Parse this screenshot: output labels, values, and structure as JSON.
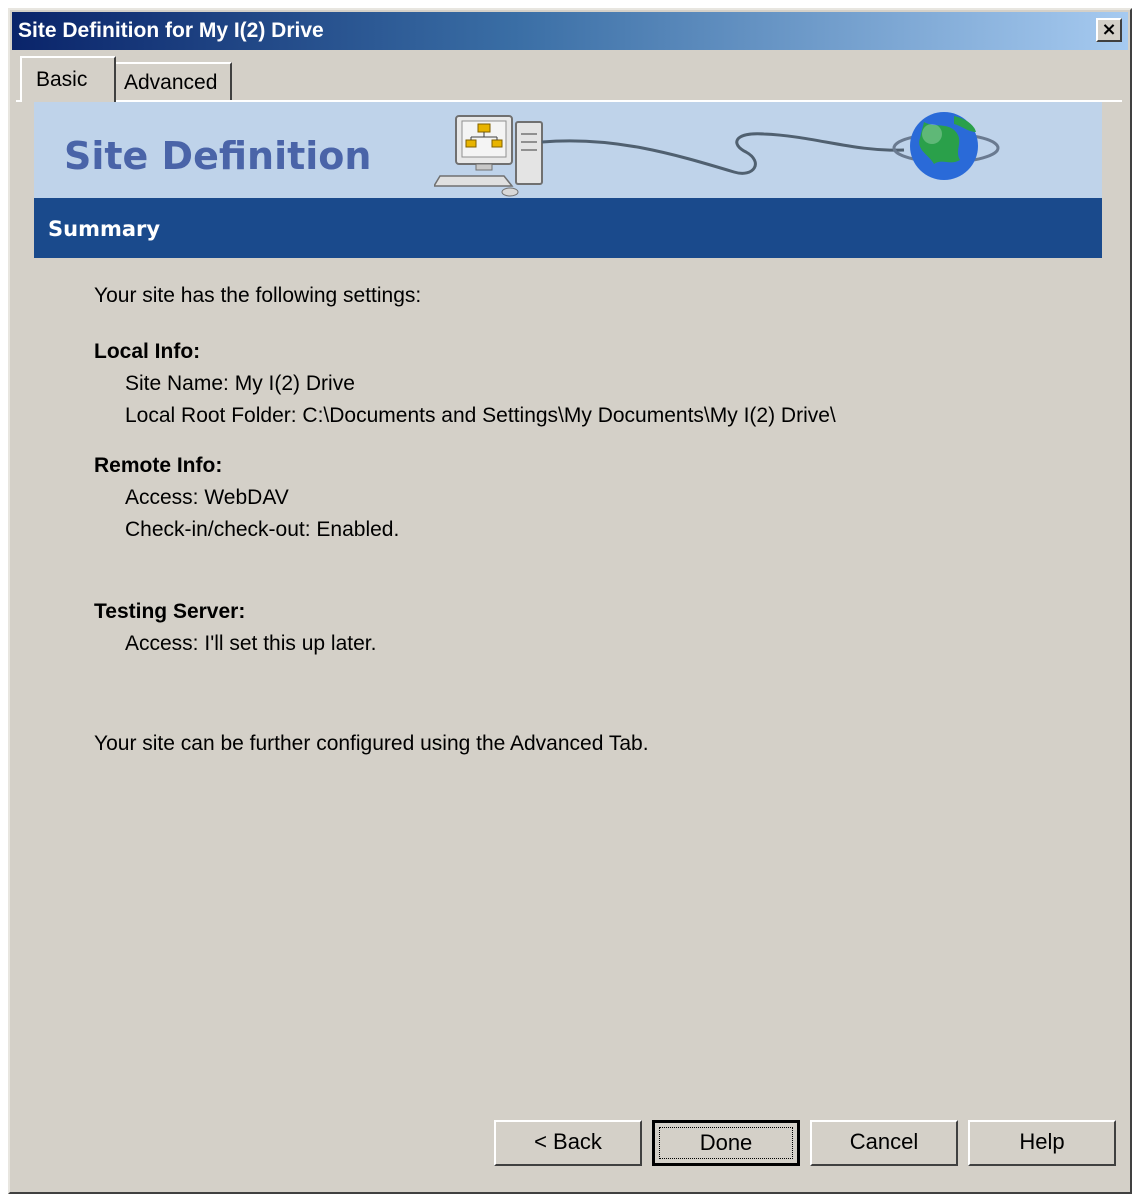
{
  "window": {
    "title": "Site Definition for My I(2) Drive",
    "close_label": "×"
  },
  "tabs": [
    {
      "label": "Basic",
      "active": true
    },
    {
      "label": "Advanced",
      "active": false
    }
  ],
  "banner": {
    "title": "Site Definition",
    "art_icons": [
      "computer-icon",
      "cable-icon",
      "globe-icon"
    ]
  },
  "section": {
    "title": "Summary"
  },
  "summary": {
    "intro": "Your site has the following settings:",
    "local_info": {
      "heading": "Local Info:",
      "site_name": "Site Name: My I(2) Drive",
      "local_root": "Local Root Folder: C:\\Documents and Settings\\My Documents\\My I(2) Drive\\"
    },
    "remote_info": {
      "heading": "Remote Info:",
      "access": "Access: WebDAV",
      "checkout": "Check-in/check-out: Enabled."
    },
    "testing_server": {
      "heading": "Testing Server:",
      "access": "Access: I'll set this up later."
    },
    "footer": "Your site can be further configured using the Advanced Tab."
  },
  "buttons": {
    "back": "< Back",
    "done": "Done",
    "cancel": "Cancel",
    "help": "Help"
  },
  "colors": {
    "dialog_bg": "#d4d0c8",
    "banner_bg": "#bfd3ea",
    "section_bar": "#1a4a8c",
    "banner_title": "#4a64a8"
  }
}
